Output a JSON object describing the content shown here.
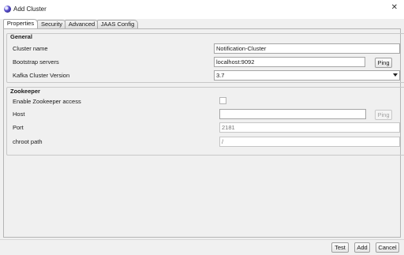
{
  "window": {
    "title": "Add Cluster",
    "close_symbol": "✕"
  },
  "tabs": [
    {
      "label": "Properties",
      "active": true
    },
    {
      "label": "Security",
      "active": false
    },
    {
      "label": "Advanced",
      "active": false
    },
    {
      "label": "JAAS Config",
      "active": false
    }
  ],
  "general": {
    "title": "General",
    "cluster_name_label": "Cluster name",
    "cluster_name_value": "Notification-Cluster",
    "bootstrap_label": "Bootstrap servers",
    "bootstrap_value": "localhost:9092",
    "ping_label": "Ping",
    "version_label": "Kafka Cluster Version",
    "version_value": "3.7"
  },
  "zookeeper": {
    "title": "Zookeeper",
    "enable_label": "Enable Zookeeper access",
    "enabled": false,
    "host_label": "Host",
    "host_value": "",
    "ping_label": "Ping",
    "port_label": "Port",
    "port_placeholder": "2181",
    "chroot_label": "chroot path",
    "chroot_placeholder": "/"
  },
  "footer": {
    "test_label": "Test",
    "add_label": "Add",
    "cancel_label": "Cancel"
  }
}
